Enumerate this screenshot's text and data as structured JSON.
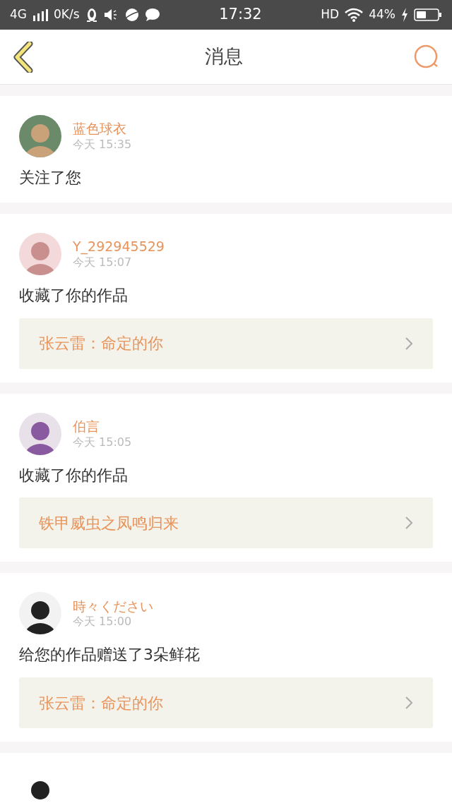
{
  "status_bar": {
    "network": "4G",
    "speed": "0K/s",
    "time": "17:32",
    "hd": "HD",
    "battery": "44%"
  },
  "header": {
    "title": "消息"
  },
  "notifications": [
    {
      "kind": "full",
      "user": "蓝色球衣",
      "time": "今天 15:35",
      "action": "关注了您"
    },
    {
      "kind": "full",
      "user": "Y_292945529",
      "time": "今天 15:07",
      "action": "收藏了你的作品",
      "work": "张云雷：命定的你"
    },
    {
      "kind": "full",
      "user": "伯言",
      "time": "今天 15:05",
      "action": "收藏了你的作品",
      "work": "铁甲威虫之凤鸣归来"
    },
    {
      "kind": "full",
      "user": "時々ください",
      "time": "今天 15:00",
      "action": "给您的作品赠送了3朵鲜花",
      "work": "张云雷：命定的你"
    },
    {
      "kind": "partial"
    }
  ]
}
